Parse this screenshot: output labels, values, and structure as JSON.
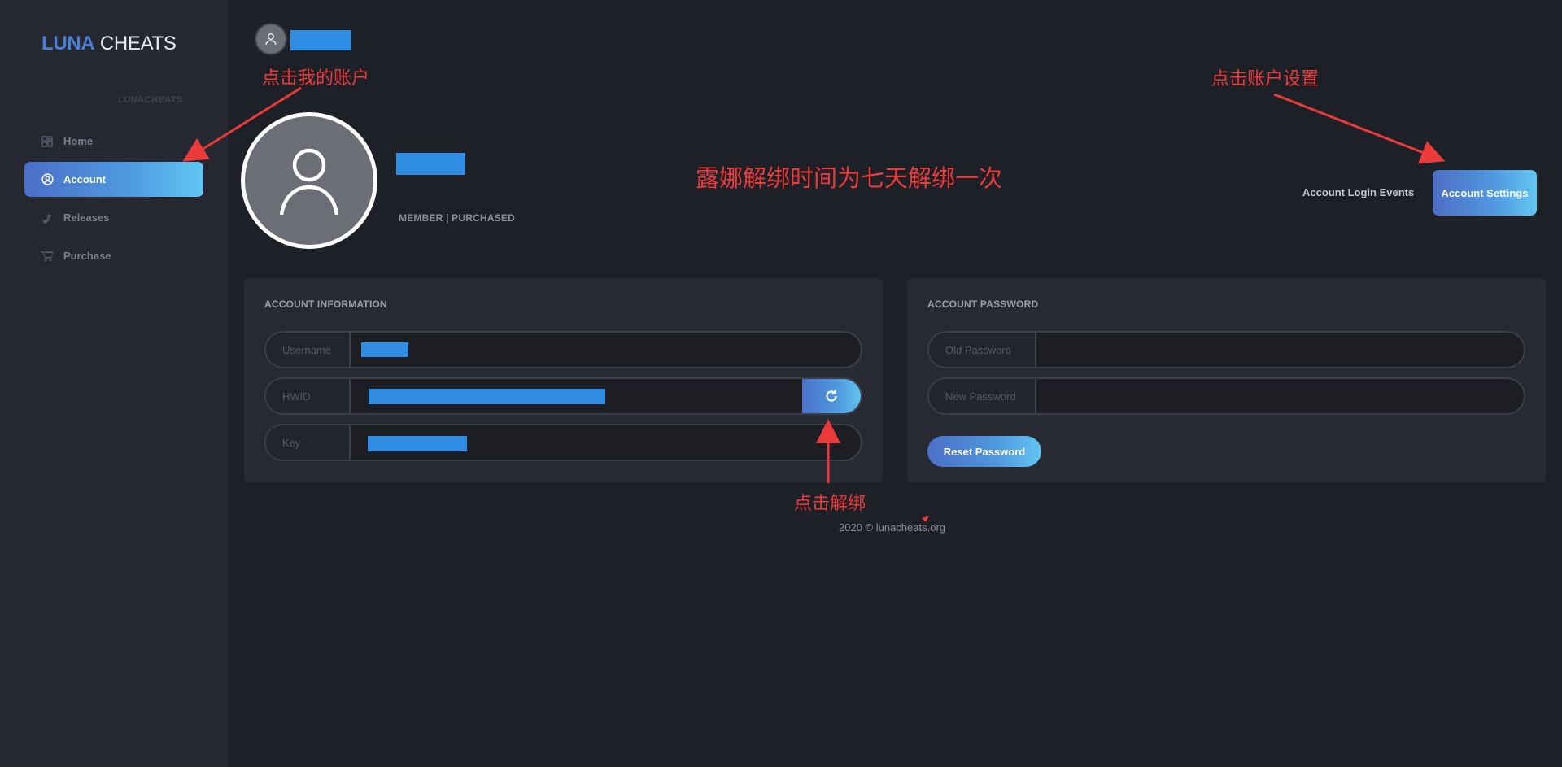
{
  "brand": {
    "part1": "LUNA",
    "part2": "CHEATS"
  },
  "sidebar": {
    "section_label": "LUNACHEATS",
    "items": [
      {
        "label": "Home",
        "icon": "grid-icon"
      },
      {
        "label": "Account",
        "icon": "user-circle-icon",
        "active": true
      },
      {
        "label": "Releases",
        "icon": "rocket-icon"
      },
      {
        "label": "Purchase",
        "icon": "cart-icon"
      }
    ]
  },
  "profile": {
    "status": "MEMBER | PURCHASED"
  },
  "header": {
    "login_events": "Account Login Events",
    "settings_button": "Account Settings"
  },
  "account_info": {
    "title": "ACCOUNT INFORMATION",
    "fields": [
      {
        "label": "Username"
      },
      {
        "label": "HWID"
      },
      {
        "label": "Key"
      }
    ]
  },
  "account_password": {
    "title": "ACCOUNT PASSWORD",
    "old_password_label": "Old Password",
    "new_password_label": "New Password",
    "reset_button": "Reset Password"
  },
  "footer": {
    "text": "2020 © lunacheats.org"
  },
  "annotations": {
    "click_my_account": "点击我的账户",
    "click_account_settings": "点击账户设置",
    "unbind_note": "露娜解绑时间为七天解绑一次",
    "click_unbind": "点击解绑"
  },
  "colors": {
    "accent_start": "#4b6fc8",
    "accent_end": "#62c6f3",
    "redaction": "#2f8de4",
    "annotation": "#ea3a3a"
  }
}
